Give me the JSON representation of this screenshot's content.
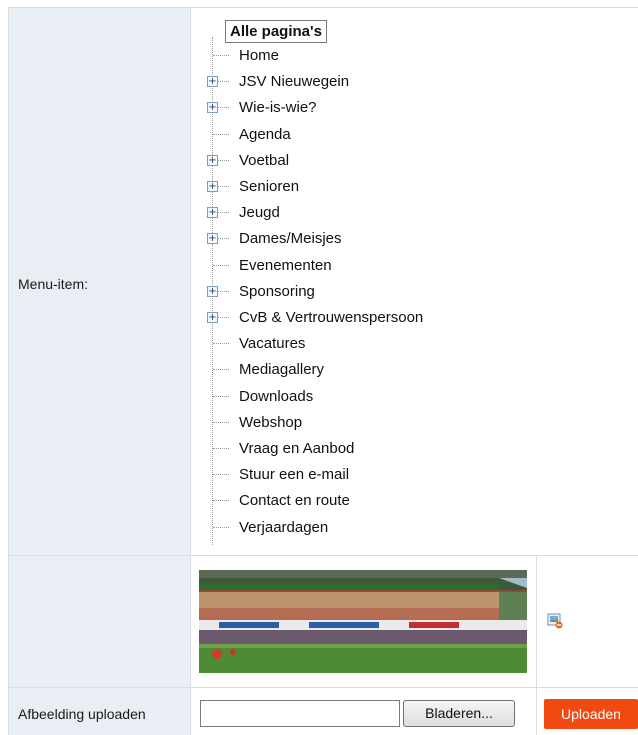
{
  "form": {
    "menu_label": "Menu-item:",
    "upload_label": "Afbeelding uploaden",
    "browse_button": "Bladeren...",
    "upload_button": "Uploaden",
    "file_value": ""
  },
  "tree": {
    "root": "Alle pagina's",
    "items": [
      {
        "label": "Home",
        "expandable": false
      },
      {
        "label": "JSV Nieuwegein",
        "expandable": true
      },
      {
        "label": "Wie-is-wie?",
        "expandable": true
      },
      {
        "label": "Agenda",
        "expandable": false
      },
      {
        "label": "Voetbal",
        "expandable": true
      },
      {
        "label": "Senioren",
        "expandable": true
      },
      {
        "label": "Jeugd",
        "expandable": true
      },
      {
        "label": "Dames/Meisjes",
        "expandable": true
      },
      {
        "label": "Evenementen",
        "expandable": false
      },
      {
        "label": "Sponsoring",
        "expandable": true
      },
      {
        "label": "CvB & Vertrouwenspersoon",
        "expandable": true
      },
      {
        "label": "Vacatures",
        "expandable": false
      },
      {
        "label": "Mediagallery",
        "expandable": false
      },
      {
        "label": "Downloads",
        "expandable": false
      },
      {
        "label": "Webshop",
        "expandable": false
      },
      {
        "label": "Vraag en Aanbod",
        "expandable": false
      },
      {
        "label": "Stuur een e-mail",
        "expandable": false
      },
      {
        "label": "Contact en route",
        "expandable": false
      },
      {
        "label": "Verjaardagen",
        "expandable": false
      }
    ]
  },
  "icons": {
    "expander": "plus-box-icon",
    "image_action": "image-delete-icon"
  },
  "colors": {
    "label_bg": "#e9eef4",
    "upload_button": "#f04a12"
  }
}
